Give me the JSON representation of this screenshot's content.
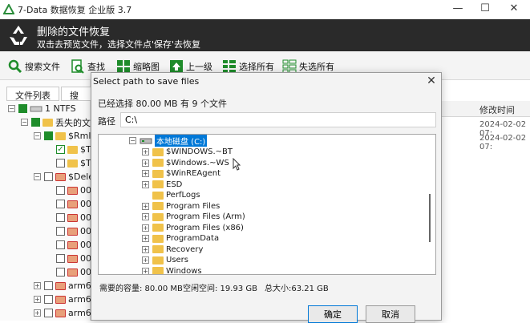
{
  "window": {
    "title": "7-Data 数据恢复 企业版 3.7",
    "controls": {
      "minimize": "—",
      "maximize": "☐",
      "close": "✕"
    }
  },
  "banner": {
    "title": "删除的文件恢复",
    "subtitle": "双击去预览文件，选择文件点'保存'去恢复"
  },
  "toolbar": {
    "search_files": "搜索文件",
    "find": "查找",
    "thumbnails": "缩略图",
    "up_level": "上一级",
    "select_all": "选择所有",
    "deselect_all": "失选所有"
  },
  "left_tabs": {
    "file_list": "文件列表",
    "search": "搜索文"
  },
  "left_tree": {
    "root": "1 NTFS",
    "lost": "丢失的文",
    "rm": "$Rml",
    "t1": "$T",
    "t2": "$T",
    "dele": "$Dele",
    "item00": "00",
    "arm": "arm6"
  },
  "right_column": {
    "header": "修改时间",
    "dates": [
      "2024-02-02 07:",
      "2024-02-02 07:"
    ]
  },
  "dialog": {
    "title": "Select path to save files",
    "close": "✕",
    "selected_info": "已经选择 80.00 MB 有 9 个文件",
    "path_label": "路径",
    "path_value": "C:\\",
    "drive": "本地磁盘 (C:)",
    "folders": [
      "$WINDOWS.~BT",
      "$Windows.~WS",
      "$WinREAgent",
      "ESD",
      "PerfLogs",
      "Program Files",
      "Program Files (Arm)",
      "Program Files (x86)",
      "ProgramData",
      "Recovery",
      "Users",
      "Windows"
    ],
    "required_space": "需要的容量: 80.00 MB",
    "free_space": "空闲空间: 19.93 GB",
    "total_size": "总大小:63.21 GB",
    "ok": "确定",
    "cancel": "取消"
  }
}
